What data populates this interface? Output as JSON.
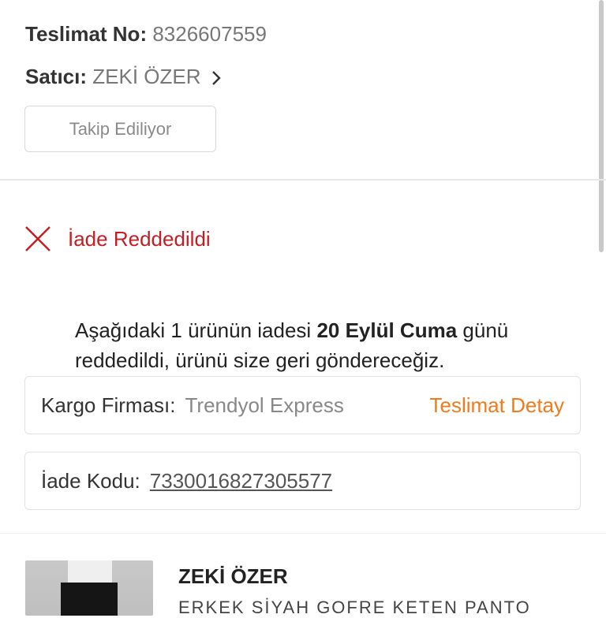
{
  "shipment": {
    "delivery_no_label": "Teslimat No:",
    "delivery_no": "8326607559",
    "seller_label": "Satıcı:",
    "seller_name": "ZEKİ ÖZER",
    "follow_button": "Takip Ediliyor"
  },
  "status": {
    "label": "İade Reddedildi",
    "icon": "close-x-icon",
    "color": "#c21f25"
  },
  "description": {
    "part1": "Aşağıdaki 1 ürünün iadesi ",
    "date": "20 Eylül Cuma",
    "part2": " günü reddedildi, ürünü size geri göndereceğiz."
  },
  "cargo": {
    "label": "Kargo Firması:",
    "company": "Trendyol Express",
    "detail_link": "Teslimat Detay",
    "accent_color": "#f27a1a"
  },
  "return_code": {
    "label": "İade Kodu:",
    "code": "7330016827305577"
  },
  "product": {
    "seller": "ZEKİ ÖZER",
    "name": "ERKEK SİYAH GOFRE KETEN PANTO"
  }
}
